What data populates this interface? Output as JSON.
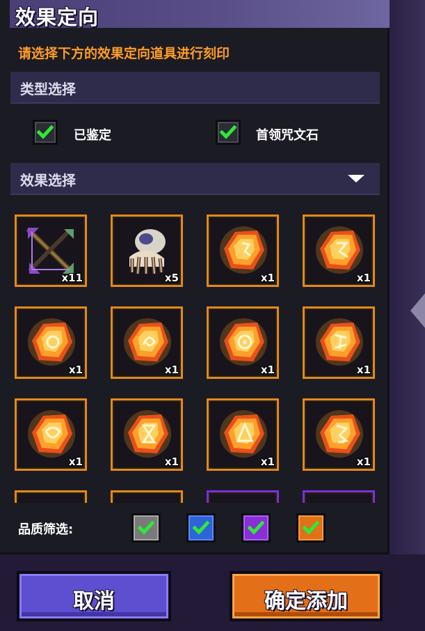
{
  "header": {
    "title": "效果定向"
  },
  "subtitle": "请选择下方的效果定向道具进行刻印",
  "type_section": {
    "label": "类型选择",
    "options": [
      {
        "label": "已鉴定",
        "checked": true
      },
      {
        "label": "首领咒文石",
        "checked": true
      }
    ]
  },
  "effect_section": {
    "label": "效果选择",
    "expanded": true
  },
  "items": [
    {
      "icon": "crossbow-icon",
      "count": "x11",
      "rarity": "legendary"
    },
    {
      "icon": "squid-creature-icon",
      "count": "x5",
      "rarity": "legendary"
    },
    {
      "icon": "rune-stone-icon",
      "count": "x1",
      "rarity": "legendary"
    },
    {
      "icon": "rune-stone-icon",
      "count": "x1",
      "rarity": "legendary"
    },
    {
      "icon": "rune-stone-icon",
      "count": "x1",
      "rarity": "legendary"
    },
    {
      "icon": "rune-stone-icon",
      "count": "x1",
      "rarity": "legendary"
    },
    {
      "icon": "rune-stone-icon",
      "count": "x1",
      "rarity": "legendary"
    },
    {
      "icon": "rune-stone-icon",
      "count": "x1",
      "rarity": "legendary"
    },
    {
      "icon": "rune-stone-icon",
      "count": "x1",
      "rarity": "legendary"
    },
    {
      "icon": "rune-stone-icon",
      "count": "x1",
      "rarity": "legendary"
    },
    {
      "icon": "rune-stone-icon",
      "count": "x1",
      "rarity": "legendary"
    },
    {
      "icon": "rune-stone-icon",
      "count": "x1",
      "rarity": "legendary"
    },
    {
      "icon": "",
      "count": "",
      "rarity": "legendary"
    },
    {
      "icon": "",
      "count": "",
      "rarity": "legendary"
    },
    {
      "icon": "",
      "count": "",
      "rarity": "epic"
    },
    {
      "icon": "",
      "count": "",
      "rarity": "epic"
    }
  ],
  "quality_filter": {
    "label": "品质筛选:",
    "options": [
      {
        "name": "common",
        "color": "#8a8a8a",
        "checked": true
      },
      {
        "name": "rare",
        "color": "#2f63d8",
        "checked": true
      },
      {
        "name": "epic",
        "color": "#8a2fd8",
        "checked": true
      },
      {
        "name": "legendary",
        "color": "#e0701a",
        "checked": true
      }
    ]
  },
  "buttons": {
    "cancel_label": "取消",
    "confirm_label": "确定添加"
  },
  "colors": {
    "accent_orange": "#ff9d27",
    "check_green": "#2ee83a",
    "legendary_border": "#e08a18",
    "epic_border": "#7a2fd8"
  }
}
